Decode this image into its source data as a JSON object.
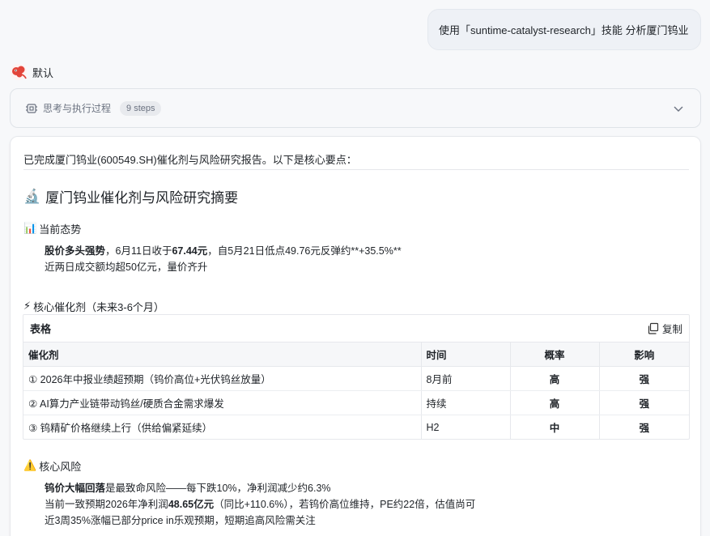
{
  "user_message": "使用「suntime-catalyst-research」技能 分析厦门钨业",
  "assistant": {
    "name": "默认",
    "process": {
      "label": "思考与执行过程",
      "steps": "9 steps"
    }
  },
  "report": {
    "intro": "已完成厦门钨业(600549.SH)催化剂与风险研究报告。以下是核心要点：",
    "title_emoji": "🔬",
    "title": "厦门钨业催化剂与风险研究摘要",
    "trend": {
      "emoji": "📊",
      "heading": "当前态势",
      "line1_bold": "股价多头强势",
      "line1_a": "，6月11日收于",
      "line1_price": "67.44元",
      "line1_b": "，自5月21日低点49.76元反弹约**+35.5%**",
      "line2": "近两日成交额均超50亿元，量价齐升"
    },
    "catalysts": {
      "emoji": "⚡",
      "heading": "核心催化剂（未来3-6个月）",
      "table_title": "表格",
      "copy_label": "复制",
      "columns": [
        "催化剂",
        "时间",
        "概率",
        "影响"
      ],
      "rows": [
        [
          "① 2026年中报业绩超预期（钨价高位+光伏钨丝放量）",
          "8月前",
          "高",
          "强"
        ],
        [
          "② AI算力产业链带动钨丝/硬质合金需求爆发",
          "持续",
          "高",
          "强"
        ],
        [
          "③ 钨精矿价格继续上行（供给偏紧延续）",
          "H2",
          "中",
          "强"
        ]
      ]
    },
    "risks": {
      "emoji": "⚠️",
      "heading": "核心风险",
      "line1_bold": "钨价大幅回落",
      "line1_rest": "是最致命风险——每下跌10%，净利润减少约6.3%",
      "line2_a": "当前一致预期2026年净利润",
      "line2_bold": "48.65亿元",
      "line2_b": "（同比+110.6%），若钨价高位维持，PE约22倍，估值尚可",
      "line3": "近3周35%涨幅已部分price in乐观预期，短期追高风险需关注"
    }
  }
}
